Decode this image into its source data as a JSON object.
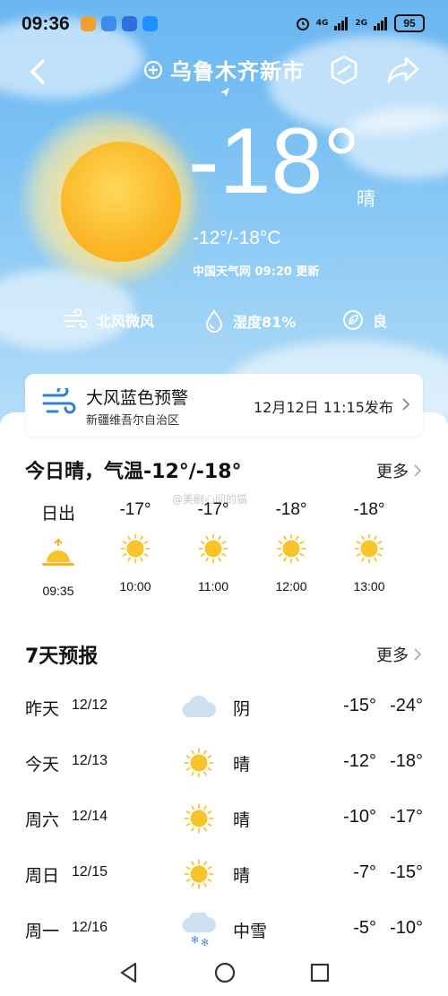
{
  "status_bar": {
    "time": "09:36",
    "network_1": "4G",
    "network_2": "2G",
    "battery": "95"
  },
  "header": {
    "city": "乌鲁木齐新市"
  },
  "current": {
    "temperature": "-18°",
    "condition": "晴",
    "range": "-12°/-18°C",
    "update": "中国天气网 09:20 更新"
  },
  "metrics": {
    "wind": "北风微风",
    "humidity": "湿度81%",
    "air_quality": "良"
  },
  "alert": {
    "title": "大风蓝色预警",
    "region": "新疆维吾尔自治区",
    "published": "12月12日 11:15发布"
  },
  "today": {
    "title": "今日晴，气温-12°/-18°",
    "more": "更多",
    "watermark": "@美剧心间的猫",
    "hours": [
      {
        "label": "日出",
        "time": "09:35",
        "icon": "sunrise-icon"
      },
      {
        "label": "-17°",
        "time": "10:00",
        "icon": "sun-icon"
      },
      {
        "label": "-17°",
        "time": "11:00",
        "icon": "sun-icon"
      },
      {
        "label": "-18°",
        "time": "12:00",
        "icon": "sun-icon"
      },
      {
        "label": "-18°",
        "time": "13:00",
        "icon": "sun-icon"
      }
    ]
  },
  "forecast": {
    "title": "7天预报",
    "more": "更多",
    "days": [
      {
        "name": "昨天",
        "date": "12/12",
        "icon": "cloud-icon",
        "desc": "阴",
        "high": "-15°",
        "low": "-24°"
      },
      {
        "name": "今天",
        "date": "12/13",
        "icon": "sun-icon",
        "desc": "晴",
        "high": "-12°",
        "low": "-18°"
      },
      {
        "name": "周六",
        "date": "12/14",
        "icon": "sun-icon",
        "desc": "晴",
        "high": "-10°",
        "low": "-17°"
      },
      {
        "name": "周日",
        "date": "12/15",
        "icon": "sun-icon",
        "desc": "晴",
        "high": "-7°",
        "low": "-15°"
      },
      {
        "name": "周一",
        "date": "12/16",
        "icon": "snow-cloud-icon",
        "desc": "中雪",
        "high": "-5°",
        "low": "-10°"
      }
    ]
  },
  "colors": {
    "sky": "#7cc2f4",
    "sun": "#fbb726",
    "alert_icon": "#2f80d8"
  }
}
